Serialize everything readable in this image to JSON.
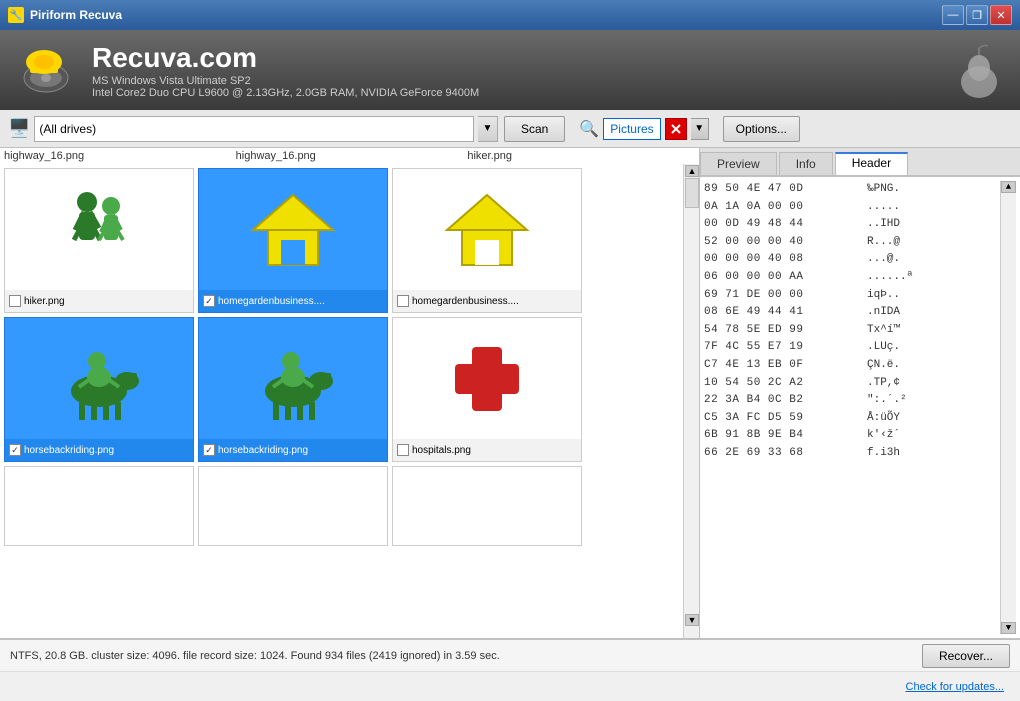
{
  "titlebar": {
    "title": "Piriform Recuva",
    "minimize_label": "—",
    "restore_label": "❐",
    "close_label": "✕"
  },
  "header": {
    "app_name": "Recuva.com",
    "line1": "MS Windows Vista Ultimate SP2",
    "line2": "Intel Core2 Duo CPU L9600 @ 2.13GHz, 2.0GB RAM, NVIDIA GeForce 9400M"
  },
  "toolbar": {
    "drive_value": "(All drives)",
    "scan_label": "Scan",
    "filter_text": "Pictures",
    "options_label": "Options..."
  },
  "tabs": {
    "preview": "Preview",
    "info": "Info",
    "header": "Header"
  },
  "hex_data": [
    {
      "bytes": "89 50 4E 47 0D",
      "chars": "‰PNG."
    },
    {
      "bytes": "0A 1A 0A 00 00",
      "chars": "....."
    },
    {
      "bytes": "00 0D 49 48 44",
      "chars": "..IHD"
    },
    {
      "bytes": "52 00 00 00 40",
      "chars": "R...@"
    },
    {
      "bytes": "00 00 00 40 08",
      "chars": "...@."
    },
    {
      "bytes": "06 00 00 00 AA",
      "chars": "......ª"
    },
    {
      "bytes": "69 71 DE 00 00",
      "chars": "iqÞ.."
    },
    {
      "bytes": "08 6E 49 44 41",
      "chars": ".nIDA"
    },
    {
      "bytes": "54 78 5E ED 99",
      "chars": "Tx^í™"
    },
    {
      "bytes": "7F 4C 55 E7 19",
      "chars": ".LUç."
    },
    {
      "bytes": "C7 4E 13 EB 0F",
      "chars": "ÇN.ë."
    },
    {
      "bytes": "10 54 50 2C A2",
      "chars": ".TP,¢"
    },
    {
      "bytes": "22 3A B4 0C B2",
      "chars": "\":.´.²"
    },
    {
      "bytes": "C5 3A FC D5 59",
      "chars": "Å:üÕY"
    },
    {
      "bytes": "6B 91 8B 9E B4",
      "chars": "k'‹ž´"
    },
    {
      "bytes": "66 2E 69 33 68",
      "chars": "f.i3h"
    }
  ],
  "files": {
    "row0_names": [
      "highway_16.png",
      "highway_16.png",
      "hiker.png"
    ],
    "row1": [
      {
        "name": "hiker.png",
        "selected": false,
        "checked": false
      },
      {
        "name": "homegardenbusiness....",
        "selected": true,
        "checked": true
      },
      {
        "name": "homegardenbusiness....",
        "selected": false,
        "checked": false
      }
    ],
    "row2": [
      {
        "name": "horsebackriding.png",
        "selected": true,
        "checked": true
      },
      {
        "name": "horsebackriding.png",
        "selected": true,
        "checked": true
      },
      {
        "name": "hospitals.png",
        "selected": false,
        "checked": false
      }
    ],
    "row3": [
      {
        "name": "",
        "selected": false,
        "checked": false
      },
      {
        "name": "",
        "selected": false,
        "checked": false
      },
      {
        "name": "",
        "selected": false,
        "checked": false
      }
    ]
  },
  "status": {
    "text": "NTFS, 20.8 GB. cluster size: 4096. file record size: 1024. Found 934 files (2419 ignored) in 3.59 sec.",
    "recover_label": "Recover..."
  },
  "footer": {
    "check_updates": "Check for updates..."
  }
}
